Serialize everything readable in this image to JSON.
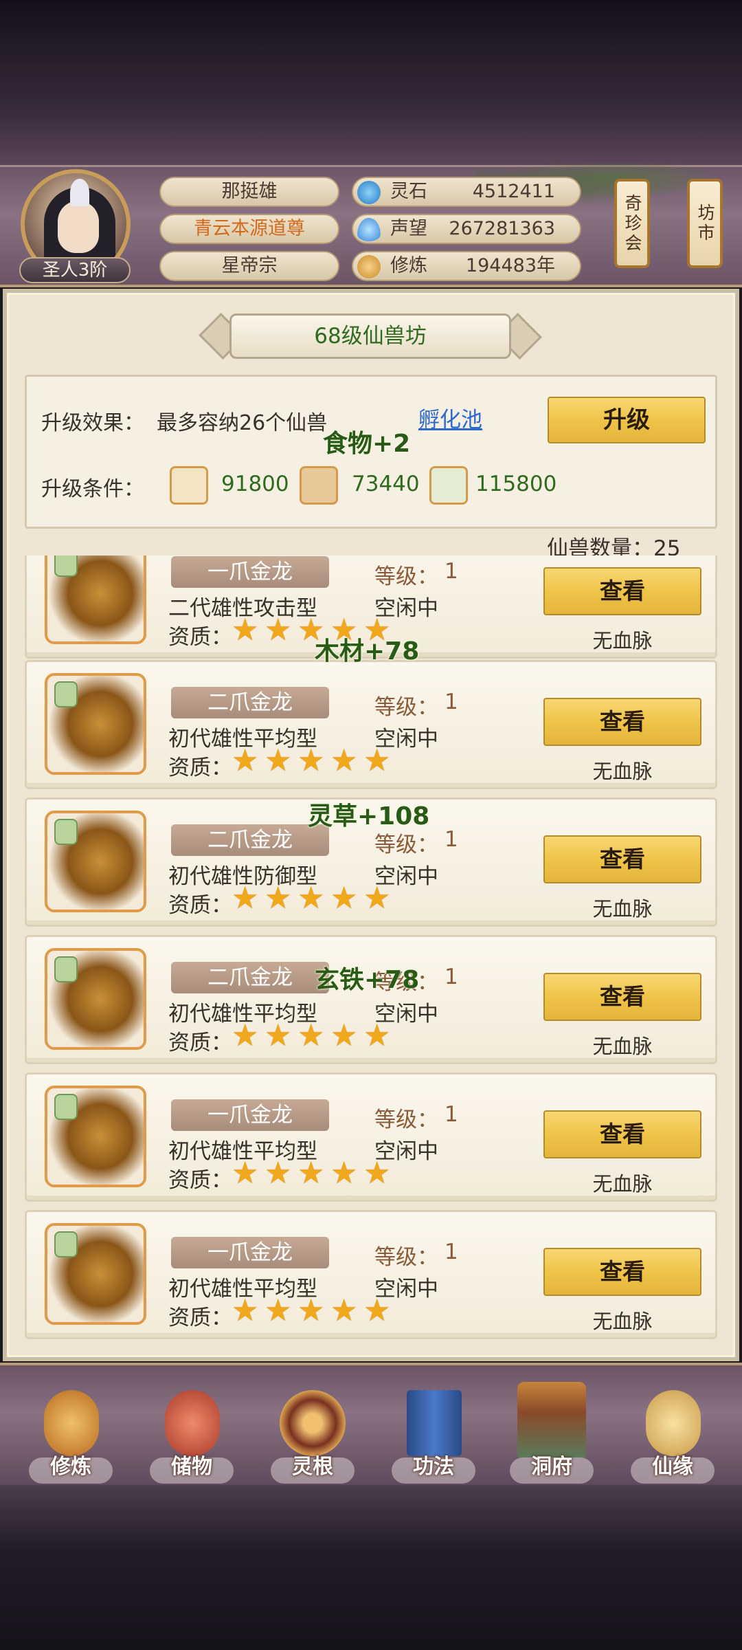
{
  "player": {
    "rank": "圣人3阶",
    "name": "那挺雄",
    "title": "青云本源道尊",
    "sect": "星帝宗"
  },
  "resources": [
    {
      "label": "灵石",
      "value": "4512411",
      "icon": "spirit-stone-icon"
    },
    {
      "label": "声望",
      "value": "267281363",
      "icon": "reputation-icon"
    },
    {
      "label": "修炼",
      "value": "194483年",
      "icon": "cultivation-icon"
    }
  ],
  "side_buttons": {
    "treasure": "奇珍会",
    "market": "坊市"
  },
  "page_title": "68级仙兽坊",
  "upgrade": {
    "effect_label": "升级效果：",
    "effect_text": "最多容纳26个仙兽",
    "hatch_link": "孵化池",
    "button": "升级",
    "condition_label": "升级条件：",
    "costs": [
      {
        "icon": "ore-icon",
        "value": "91800"
      },
      {
        "icon": "wood-icon",
        "value": "73440"
      },
      {
        "icon": "herb-icon",
        "value": "115800"
      }
    ]
  },
  "beast_count": "仙兽数量：25",
  "float_gains": [
    "食物+2",
    "木材+78",
    "灵草+108",
    "玄铁+78"
  ],
  "labels": {
    "level_prefix": "等级：",
    "quality": "资质：",
    "view": "查看"
  },
  "beasts": [
    {
      "name": "一爪金龙",
      "level": "1",
      "type": "二代雄性攻击型",
      "status": "空闲中",
      "stars": 5,
      "bloodline": "无血脉"
    },
    {
      "name": "二爪金龙",
      "level": "1",
      "type": "初代雄性平均型",
      "status": "空闲中",
      "stars": 5,
      "bloodline": "无血脉"
    },
    {
      "name": "二爪金龙",
      "level": "1",
      "type": "初代雄性防御型",
      "status": "空闲中",
      "stars": 5,
      "bloodline": "无血脉"
    },
    {
      "name": "二爪金龙",
      "level": "1",
      "type": "初代雄性平均型",
      "status": "空闲中",
      "stars": 5,
      "bloodline": "无血脉"
    },
    {
      "name": "一爪金龙",
      "level": "1",
      "type": "初代雄性平均型",
      "status": "空闲中",
      "stars": 5,
      "bloodline": "无血脉"
    },
    {
      "name": "一爪金龙",
      "level": "1",
      "type": "初代雄性平均型",
      "status": "空闲中",
      "stars": 5,
      "bloodline": "无血脉"
    }
  ],
  "nav": [
    {
      "label": "修炼",
      "icon": "cultivate-icon",
      "color": "#d89a3a"
    },
    {
      "label": "储物",
      "icon": "storage-bag-icon",
      "color": "#c8503a"
    },
    {
      "label": "灵根",
      "icon": "spirit-root-icon",
      "color": "#a8442a"
    },
    {
      "label": "功法",
      "icon": "scripture-book-icon",
      "color": "#3a6aa8"
    },
    {
      "label": "洞府",
      "icon": "cave-mansion-icon",
      "color": "#c8843a"
    },
    {
      "label": "仙缘",
      "icon": "immortal-fate-icon",
      "color": "#d8b058"
    }
  ]
}
